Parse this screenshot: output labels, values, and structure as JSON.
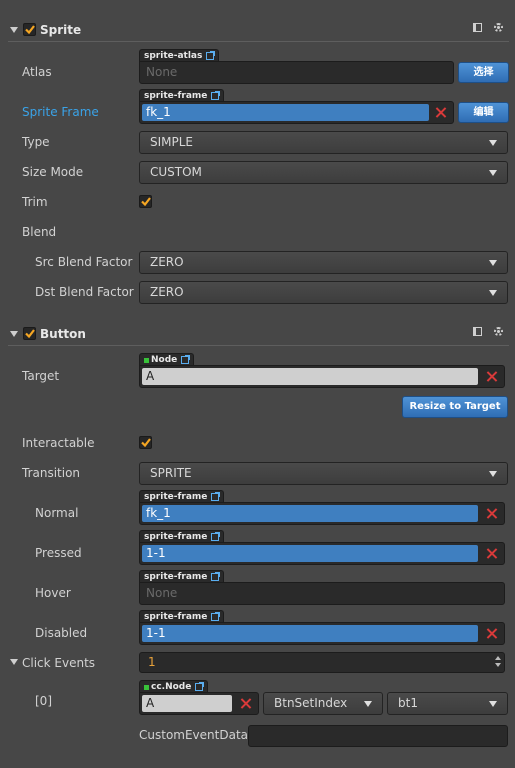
{
  "sprite": {
    "title": "Sprite",
    "enabled": true,
    "atlas": {
      "label": "Atlas",
      "tag": "sprite-atlas",
      "value": "None",
      "button": "选择"
    },
    "sprite_frame": {
      "label": "Sprite Frame",
      "tag": "sprite-frame",
      "value": "fk_1",
      "button": "编辑"
    },
    "type": {
      "label": "Type",
      "value": "SIMPLE"
    },
    "size_mode": {
      "label": "Size Mode",
      "value": "CUSTOM"
    },
    "trim": {
      "label": "Trim",
      "checked": true
    },
    "blend": {
      "label": "Blend"
    },
    "src_blend": {
      "label": "Src Blend Factor",
      "value": "ZERO"
    },
    "dst_blend": {
      "label": "Dst Blend Factor",
      "value": "ZERO"
    }
  },
  "button": {
    "title": "Button",
    "enabled": true,
    "target": {
      "label": "Target",
      "tag": "Node",
      "value": "A"
    },
    "resize_button": "Resize to Target",
    "interactable": {
      "label": "Interactable",
      "checked": true
    },
    "transition": {
      "label": "Transition",
      "value": "SPRITE"
    },
    "normal": {
      "label": "Normal",
      "tag": "sprite-frame",
      "value": "fk_1"
    },
    "pressed": {
      "label": "Pressed",
      "tag": "sprite-frame",
      "value": "1-1"
    },
    "hover": {
      "label": "Hover",
      "tag": "sprite-frame",
      "value": "None"
    },
    "disabled": {
      "label": "Disabled",
      "tag": "sprite-frame",
      "value": "1-1"
    },
    "click_events": {
      "label": "Click Events",
      "count": "1"
    },
    "event0": {
      "label": "[0]",
      "tag": "cc.Node",
      "node": "A",
      "component": "BtnSetIndex",
      "handler": "bt1",
      "custom_label": "CustomEventData",
      "custom_value": ""
    }
  },
  "colors": {
    "accent": "#3f7fc0",
    "checkbox": "#f5a623",
    "label_highlight": "#3aa3e8",
    "remove": "#d93a3a"
  },
  "icons": [
    "chevron-down-icon",
    "checkbox-icon",
    "book-icon",
    "gear-icon",
    "external-link-icon",
    "close-icon"
  ]
}
